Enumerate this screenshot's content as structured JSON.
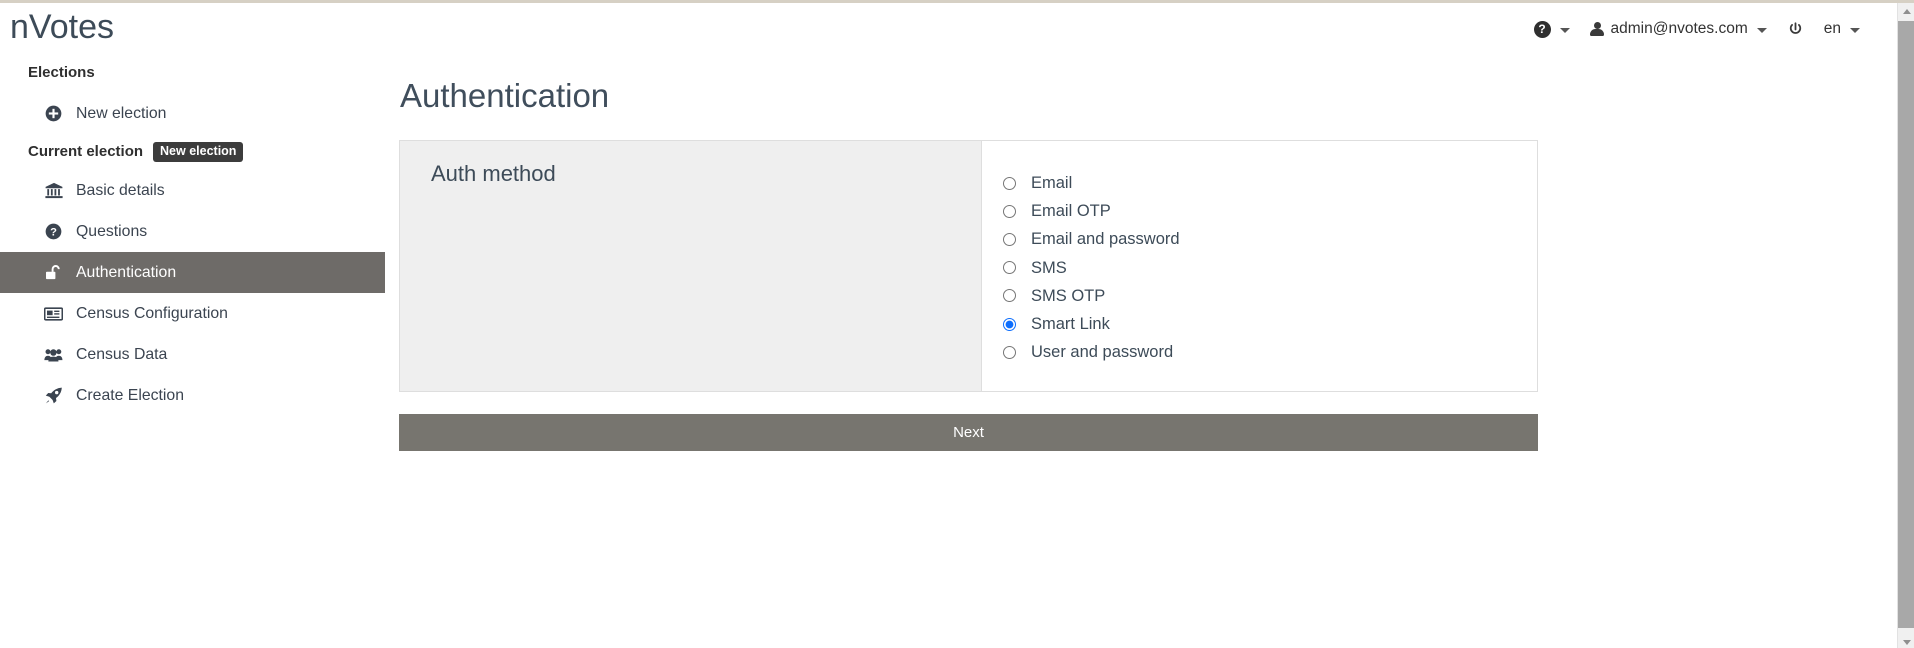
{
  "brand": {
    "name": "nVotes"
  },
  "header": {
    "help": {
      "icon": "question-circle-icon",
      "label": ""
    },
    "user": {
      "icon": "user-icon",
      "email": "admin@nvotes.com"
    },
    "power": {
      "icon": "power-icon"
    },
    "language": {
      "value": "en"
    }
  },
  "sidebar": {
    "sections": [
      {
        "heading": "Elections",
        "badge": null
      },
      {
        "heading": "Current election",
        "badge": "New election"
      }
    ],
    "elections_items": [
      {
        "icon": "plus-circle-icon",
        "label": "New election",
        "active": false
      }
    ],
    "items": [
      {
        "icon": "bank-icon",
        "label": "Basic details",
        "active": false
      },
      {
        "icon": "question-circle-icon",
        "label": "Questions",
        "active": false
      },
      {
        "icon": "unlock-icon",
        "label": "Authentication",
        "active": true
      },
      {
        "icon": "newspaper-icon",
        "label": "Census Configuration",
        "active": false
      },
      {
        "icon": "users-icon",
        "label": "Census Data",
        "active": false
      },
      {
        "icon": "rocket-icon",
        "label": "Create Election",
        "active": false
      }
    ]
  },
  "main": {
    "title": "Authentication",
    "panel": {
      "label": "Auth method",
      "options": [
        {
          "label": "Email",
          "selected": false
        },
        {
          "label": "Email OTP",
          "selected": false
        },
        {
          "label": "Email and password",
          "selected": false
        },
        {
          "label": "SMS",
          "selected": false
        },
        {
          "label": "SMS OTP",
          "selected": false
        },
        {
          "label": "Smart Link",
          "selected": true
        },
        {
          "label": "User and password",
          "selected": false
        }
      ]
    },
    "next_label": "Next"
  },
  "colors": {
    "brand_text": "#3d4b58",
    "active_nav_bg": "#6e6b68",
    "panel_bg": "#efefef",
    "next_button_bg": "#77756f",
    "radio_selected": "#0d6efd",
    "badge_bg": "#3c3c3c"
  }
}
